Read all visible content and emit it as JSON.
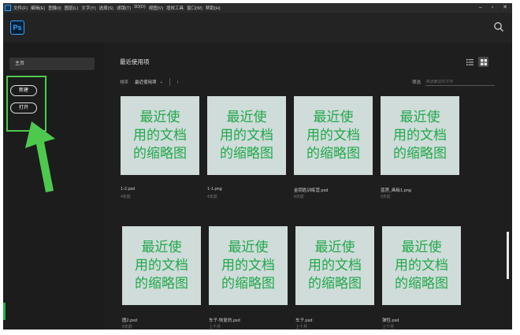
{
  "menubar": {
    "items": [
      "文件(F)",
      "编辑(E)",
      "图像(I)",
      "图层(L)",
      "文字(Y)",
      "选择(S)",
      "滤镜(T)",
      "3D(D)",
      "视图(V)",
      "增效工具",
      "窗口(W)",
      "帮助(H)"
    ],
    "minimize": "–",
    "restore": "▫",
    "close": "✕"
  },
  "appbar": {
    "logo": "Ps",
    "search_icon": "search-icon"
  },
  "sidebar": {
    "home_label": "主页",
    "new_label": "新建",
    "open_label": "打开",
    "highlight_color": "#4ec94e"
  },
  "main": {
    "section_title": "最近使用项",
    "sort_label": "排序",
    "sort_value": "最近使用项",
    "sort_chevron": "⌄",
    "sort_direction": "↓",
    "filter_label": "筛选",
    "filter_placeholder": "筛选最近的文件",
    "list_view_icon": "list-view-icon",
    "grid_view_icon": "grid-view-icon"
  },
  "thumb_caption": "最近使用的文档的缩略图",
  "thumb_lines": [
    "最近使",
    "用的文档",
    "的缩略图"
  ],
  "files": [
    {
      "name": "1-2.psd",
      "date": "4年前"
    },
    {
      "name": "1-1.png",
      "date": "4年前"
    },
    {
      "name": "金钥匙训练营.psd",
      "date": "8天前"
    },
    {
      "name": "蓝莲_画板1.png",
      "date": "9天前"
    },
    {
      "name": "图2.psd",
      "date": "9天前"
    },
    {
      "name": "车子-恢复的.psd",
      "date": "上个月"
    },
    {
      "name": "车子.psd",
      "date": "上个月"
    },
    {
      "name": "弹性.psd",
      "date": "上个月"
    }
  ],
  "colors": {
    "accent": "#31a8ff",
    "thumb_bg": "#cfdcda",
    "thumb_text": "#21a84a",
    "annotation": "#4ec94e"
  }
}
